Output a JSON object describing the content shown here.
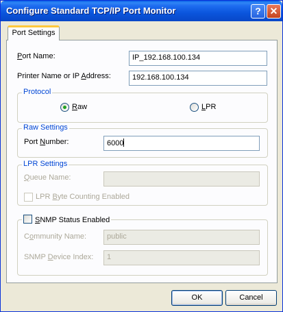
{
  "window": {
    "title": "Configure Standard TCP/IP Port Monitor",
    "help_glyph": "?",
    "close_glyph": "✕"
  },
  "tabs": [
    {
      "label": "Port Settings"
    }
  ],
  "fields": {
    "port_name": {
      "label_prefix": "",
      "label_mnemonic": "P",
      "label_suffix": "ort Name:",
      "value": "IP_192.168.100.134"
    },
    "printer_address": {
      "label_prefix": "Printer Name or IP ",
      "label_mnemonic": "A",
      "label_suffix": "ddress:",
      "value": "192.168.100.134"
    }
  },
  "protocol": {
    "legend": "Protocol",
    "raw": {
      "mnemonic": "R",
      "rest": "aw",
      "selected": true
    },
    "lpr": {
      "mnemonic": "L",
      "rest": "PR",
      "selected": false
    }
  },
  "raw_settings": {
    "legend": "Raw Settings",
    "port_number": {
      "label_prefix": "Port ",
      "label_mnemonic": "N",
      "label_suffix": "umber:",
      "value": "6000"
    }
  },
  "lpr_settings": {
    "legend": "LPR Settings",
    "queue_name": {
      "label_mnemonic": "Q",
      "label_suffix": "ueue Name:",
      "value": ""
    },
    "byte_counting": {
      "label_prefix": "LPR ",
      "label_mnemonic": "B",
      "label_suffix": "yte Counting Enabled",
      "checked": false
    }
  },
  "snmp": {
    "enabled": {
      "label_mnemonic": "S",
      "label_suffix": "NMP Status Enabled",
      "checked": false
    },
    "community_name": {
      "label_prefix": "C",
      "label_mnemonic": "o",
      "label_suffix": "mmunity Name:",
      "value": "public"
    },
    "device_index": {
      "label_prefix": "SNMP ",
      "label_mnemonic": "D",
      "label_suffix": "evice Index:",
      "value": "1"
    }
  },
  "buttons": {
    "ok": "OK",
    "cancel": "Cancel"
  }
}
